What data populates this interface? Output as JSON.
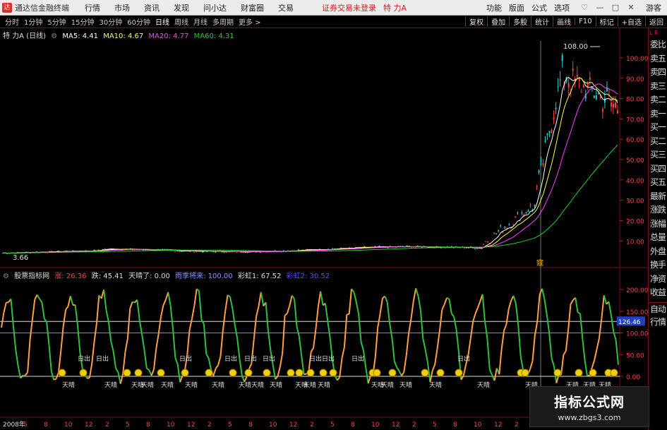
{
  "app": {
    "title": "通达信金融终端",
    "logo_char": "达"
  },
  "menu": [
    "行情",
    "市场",
    "资讯",
    "发现",
    "问小达",
    "财富圈",
    "交易"
  ],
  "notice": "证券交易未登录",
  "stock_name": "特 力A",
  "right_menu": [
    "功能",
    "版面",
    "公式",
    "选项"
  ],
  "window_controls": [
    "♡",
    "—",
    "□",
    "✕"
  ],
  "guest": "游客",
  "periods": [
    "分时",
    "1分钟",
    "5分钟",
    "15分钟",
    "30分钟",
    "60分钟",
    "日线",
    "周线",
    "月线",
    "多周期",
    "更多 >"
  ],
  "active_period": "日线",
  "tools": [
    "复权",
    "叠加",
    "多股",
    "统计",
    "画线",
    "F10",
    "标记",
    "+自选",
    "返回"
  ],
  "main_info": {
    "name": "特 力A (日线)",
    "ma5": "MA5: 4.41",
    "ma10": "MA10: 4.67",
    "ma20": "MA20: 4.77",
    "ma60": "MA60: 4.31"
  },
  "sub_info": {
    "name": "股票指标网",
    "a": "涨: 26.36",
    "b": "跌: 45.41",
    "c": "天晴了: 0.00",
    "d": "雨季将来: 100.00",
    "e": "彩虹1: 67.52",
    "f": "彩虹2: 30.52"
  },
  "side_items": [
    "委比",
    "卖五",
    "卖四",
    "卖三",
    "卖二",
    "卖一",
    "买一",
    "买二",
    "买三",
    "买四",
    "买五",
    "最新",
    "涨跌",
    "涨幅",
    "总量",
    "外盘",
    "换手",
    "净资",
    "收益",
    "自动",
    "行情"
  ],
  "lr": "L R",
  "main_axis": [
    "100.00",
    "90.00",
    "80.00",
    "70.00",
    "60.00",
    "50.00",
    "40.00",
    "30.00",
    "20.00",
    "10.00"
  ],
  "sub_axis": [
    "200.00",
    "150.00",
    "100.00",
    "50.00",
    "0.00"
  ],
  "sub_current": "126.46",
  "price_high": "108.00",
  "price_low": "3.66",
  "marker_char": "寇",
  "time_axis": [
    "2008年",
    "5",
    "8",
    "10",
    "12",
    "2",
    "5",
    "8",
    "10",
    "12",
    "2",
    "5",
    "8",
    "10",
    "12",
    "2",
    "5",
    "8",
    "10",
    "12",
    "2",
    "5",
    "8",
    "10",
    "12",
    "2",
    "5",
    "8",
    "10",
    "12"
  ],
  "labels": {
    "out": "日出",
    "sky": "天晴"
  },
  "watermark": {
    "title": "指标公式网",
    "url": "www.zbgs3.com"
  },
  "colors": {
    "up": "#ff4040",
    "down": "#20d0d0",
    "ma5": "#ffffff",
    "ma10": "#ffff40",
    "ma20": "#ff40ff",
    "ma60": "#20d020",
    "osc_up": "#ffa040",
    "osc_down": "#30c040",
    "sun": "#f0d000"
  }
}
